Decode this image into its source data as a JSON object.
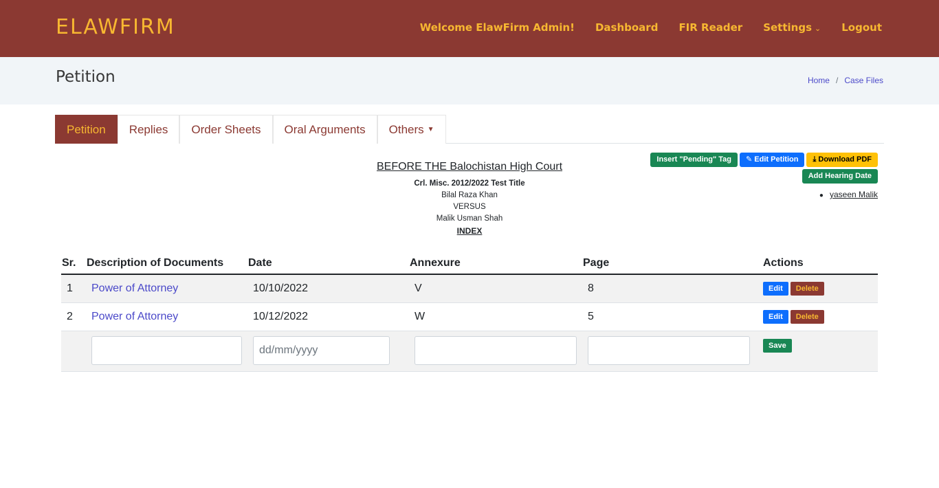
{
  "header": {
    "logo": "ELAWFIRM",
    "nav": {
      "welcome": "Welcome ElawFirm Admin!",
      "dashboard": "Dashboard",
      "fir_reader": "FIR Reader",
      "settings": "Settings",
      "logout": "Logout"
    }
  },
  "band": {
    "title": "Petition",
    "breadcrumb": {
      "home": "Home",
      "sep": "/",
      "current": "Case Files"
    }
  },
  "tabs": [
    {
      "label": "Petition",
      "active": true
    },
    {
      "label": "Replies"
    },
    {
      "label": "Order Sheets"
    },
    {
      "label": "Oral Arguments"
    },
    {
      "label": "Others"
    }
  ],
  "court": {
    "title": "BEFORE THE Balochistan High Court",
    "case": "Crl. Misc. 2012/2022 Test Title",
    "petitioner": "Bilal Raza Khan",
    "versus": "VERSUS",
    "respondent": "Malik Usman Shah",
    "index": "INDEX"
  },
  "actions": {
    "insert_pending": "Insert \"Pending\" Tag",
    "edit_petition": "Edit Petition",
    "download_pdf": "Download PDF",
    "add_hearing": "Add Hearing Date",
    "assignee": "yaseen Malik"
  },
  "table": {
    "headers": [
      "Sr.",
      "Description of Documents",
      "Date",
      "Annexure",
      "Page",
      "Actions"
    ],
    "rows": [
      {
        "sr": "1",
        "description": "Power of Attorney",
        "date": "10/10/2022",
        "annexure": "V",
        "page": "8"
      },
      {
        "sr": "2",
        "description": "Power of Attorney",
        "date": "10/12/2022",
        "annexure": "W",
        "page": "5"
      }
    ],
    "edit_label": "Edit",
    "delete_label": "Delete",
    "save_label": "Save",
    "date_placeholder": "dd/mm/yyyy"
  }
}
